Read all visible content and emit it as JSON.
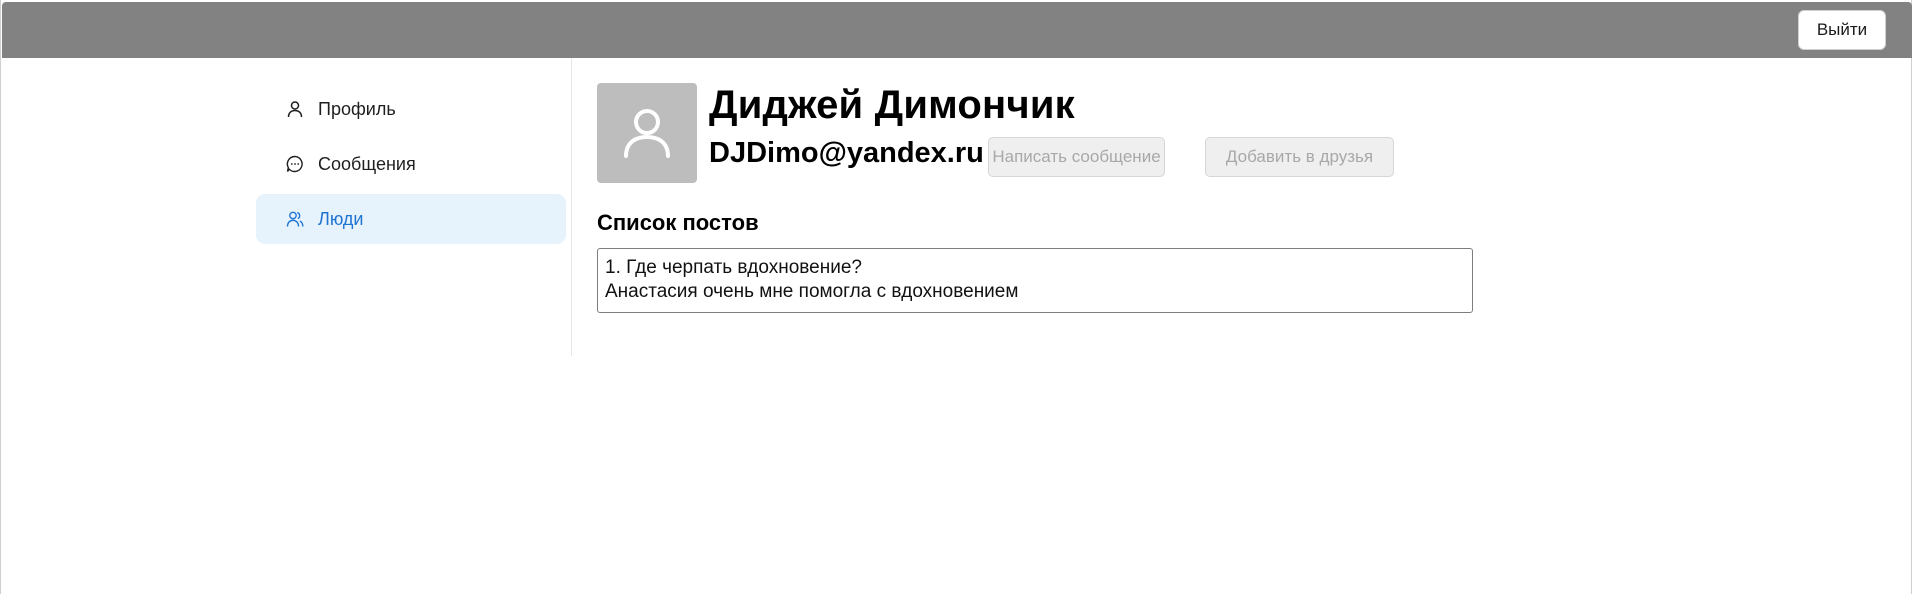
{
  "header": {
    "logout_label": "Выйти"
  },
  "sidebar": {
    "items": [
      {
        "label": "Профиль",
        "icon": "user-icon",
        "active": false
      },
      {
        "label": "Сообщения",
        "icon": "chat-bubble-icon",
        "active": false
      },
      {
        "label": "Люди",
        "icon": "people-icon",
        "active": true
      }
    ],
    "active_color": "#1f74d1",
    "active_background": "#e6f2fc"
  },
  "profile": {
    "avatar_icon": "avatar-placeholder-icon",
    "name": "Диджей Димончик",
    "email": "DJDimo@yandex.ru",
    "message_button_label": "Написать сообщение",
    "add_friend_button_label": "Добавить в друзья"
  },
  "posts": {
    "title": "Список постов",
    "items": [
      {
        "title_line": "1. Где черпать вдохновение?",
        "body": "Анастасия очень мне помогла с вдохновением"
      }
    ]
  },
  "colors": {
    "topbar": "#828282",
    "disabled_button_bg": "#efefef",
    "disabled_button_text": "#a8a8a8"
  }
}
